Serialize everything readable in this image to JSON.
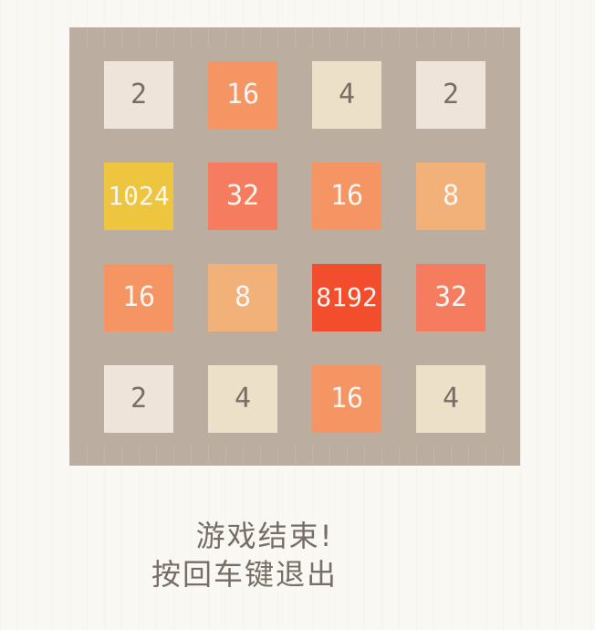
{
  "grid": [
    [
      "2",
      "16",
      "4",
      "2"
    ],
    [
      "1024",
      "32",
      "16",
      "8"
    ],
    [
      "16",
      "8",
      "8192",
      "32"
    ],
    [
      "2",
      "4",
      "16",
      "4"
    ]
  ],
  "tile_colors": {
    "2": {
      "bg": "#eee4da",
      "fg": "#776e65"
    },
    "4": {
      "bg": "#ede0c8",
      "fg": "#776e65"
    },
    "8": {
      "bg": "#f2b179",
      "fg": "#f9f6f2"
    },
    "16": {
      "bg": "#f59563",
      "fg": "#f9f6f2"
    },
    "32": {
      "bg": "#f67c5f",
      "fg": "#f9f6f2"
    },
    "1024": {
      "bg": "#edc53f",
      "fg": "#f9f6f2"
    },
    "8192": {
      "bg": "#f24e2e",
      "fg": "#f9f6f2"
    }
  },
  "board_color": "#bbada0",
  "message": {
    "line1": "游戏结束!",
    "line2": "按回车键退出"
  }
}
